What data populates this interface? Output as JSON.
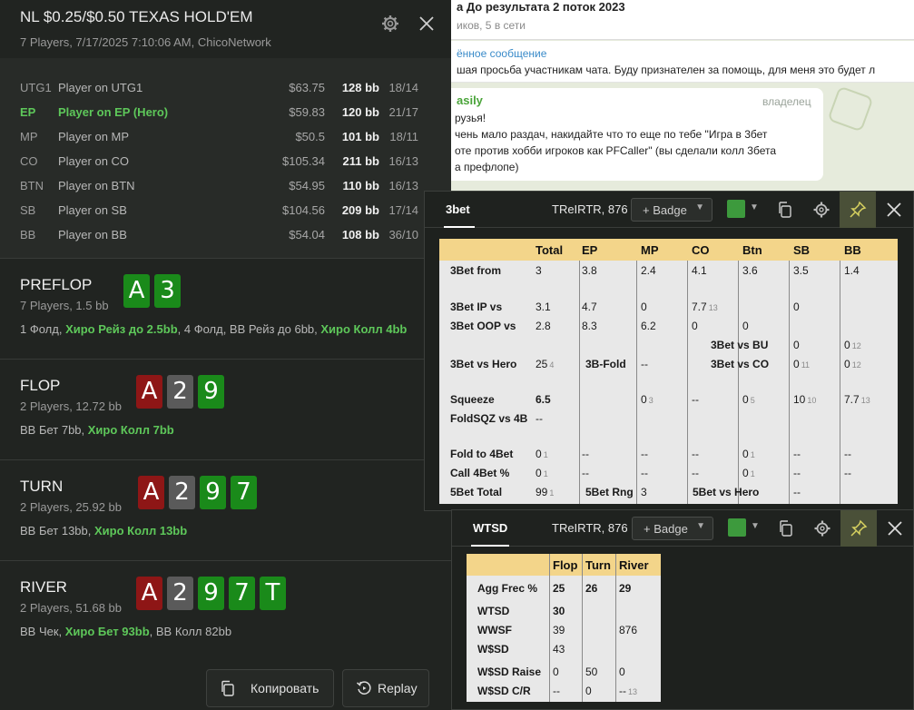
{
  "chat": {
    "title": "а До результата 2 поток 2023",
    "subtitle": "иков, 5 в сети",
    "pinned_title": "ённое сообщение",
    "pinned_text": "шая просьба участникам чата.   Буду признателен за помощь, для меня это будет л",
    "author": "asily",
    "role": "владелец",
    "lines": [
      "рузья!",
      "чень мало раздач, накидайте что то еще по тебе \"Игра в 3бет",
      "оте против хобби игроков как PFCaller\" (вы сделали колл 3бета",
      "а префлопе)"
    ]
  },
  "hand": {
    "title": "NL $0.25/$0.50 TEXAS HOLD'EM",
    "subtitle": "7 Players, 7/17/2025 7:10:06 AM, ChicoNetwork",
    "players": [
      {
        "pos": "UTG1",
        "name": "Player on UTG1",
        "money": "$63.75",
        "bb": "128 bb",
        "stat": "18/14",
        "hero": false
      },
      {
        "pos": "EP",
        "name": "Player on EP (Hero)",
        "money": "$59.83",
        "bb": "120 bb",
        "stat": "21/17",
        "hero": true
      },
      {
        "pos": "MP",
        "name": "Player on MP",
        "money": "$50.5",
        "bb": "101 bb",
        "stat": "18/11",
        "hero": false
      },
      {
        "pos": "CO",
        "name": "Player on CO",
        "money": "$105.34",
        "bb": "211 bb",
        "stat": "16/13",
        "hero": false
      },
      {
        "pos": "BTN",
        "name": "Player on BTN",
        "money": "$54.95",
        "bb": "110 bb",
        "stat": "16/13",
        "hero": false
      },
      {
        "pos": "SB",
        "name": "Player on SB",
        "money": "$104.56",
        "bb": "209 bb",
        "stat": "17/14",
        "hero": false
      },
      {
        "pos": "BB",
        "name": "Player on BB",
        "money": "$54.04",
        "bb": "108 bb",
        "stat": "36/10",
        "hero": false
      }
    ],
    "streets": [
      {
        "name": "PREFLOP",
        "players": "7 Players, 1.5 bb",
        "cards": [
          {
            "r": "A",
            "c": "green"
          },
          {
            "r": "3",
            "c": "green"
          }
        ],
        "action": [
          {
            "t": "1 Фолд, ",
            "g": false
          },
          {
            "t": "Хиро Рейз до 2.5bb",
            "g": true
          },
          {
            "t": ", 4 Фолд, BB Рейз до 6bb, ",
            "g": false
          },
          {
            "t": "Хиро Колл 4bb",
            "g": true
          }
        ]
      },
      {
        "name": "FLOP",
        "players": "2 Players, 12.72 bb",
        "cards": [
          {
            "r": "A",
            "c": "red"
          },
          {
            "r": "2",
            "c": "gray"
          },
          {
            "r": "9",
            "c": "green"
          }
        ],
        "action": [
          {
            "t": "BB Бет 7bb, ",
            "g": false
          },
          {
            "t": "Хиро Колл 7bb",
            "g": true
          }
        ]
      },
      {
        "name": "TURN",
        "players": "2 Players, 25.92 bb",
        "cards": [
          {
            "r": "A",
            "c": "red"
          },
          {
            "r": "2",
            "c": "gray"
          },
          {
            "r": "9",
            "c": "green"
          },
          {
            "r": "7",
            "c": "green"
          }
        ],
        "action": [
          {
            "t": "BB Бет 13bb, ",
            "g": false
          },
          {
            "t": "Хиро Колл 13bb",
            "g": true
          }
        ]
      },
      {
        "name": "RIVER",
        "players": "2 Players, 51.68 bb",
        "cards": [
          {
            "r": "A",
            "c": "red"
          },
          {
            "r": "2",
            "c": "gray"
          },
          {
            "r": "9",
            "c": "green"
          },
          {
            "r": "7",
            "c": "green"
          },
          {
            "r": "T",
            "c": "green"
          }
        ],
        "action": [
          {
            "t": "BB Чек, ",
            "g": false
          },
          {
            "t": "Хиро Бет 93bb",
            "g": true
          },
          {
            "t": ", BB Колл 82bb",
            "g": false
          }
        ]
      }
    ],
    "copy_label": "Копировать",
    "replay_label": "Replay"
  },
  "hud1": {
    "tab": "3bet",
    "player": "TReIRTR, 876",
    "badge": "+ Badge",
    "headers": [
      "Total",
      "EP",
      "MP",
      "CO",
      "Btn",
      "SB",
      "BB"
    ],
    "rows": [
      {
        "label": "3Bet from",
        "cells": [
          "3",
          "3.8",
          "2.4",
          "4.1",
          "3.6",
          "3.5",
          "1.4"
        ]
      },
      {
        "label": "3Bet IP vs",
        "cells": [
          "3.1",
          "4.7",
          "0",
          "7.7",
          "",
          "0",
          ""
        ],
        "small": [
          "",
          "",
          "",
          "13",
          "",
          "",
          ""
        ]
      },
      {
        "label": "3Bet OOP vs",
        "cells": [
          "2.8",
          "8.3",
          "6.2",
          "0",
          "0",
          "",
          ""
        ]
      },
      {
        "label": "3Bet vs BU",
        "v1": "0",
        "v2": "0",
        "v2s": "12"
      },
      {
        "label": "3Bet vs Hero",
        "total": "25",
        "totals": "4",
        "mid": "3B-Fold",
        "midv": "--",
        "lbl2": "3Bet vs CO",
        "v1": "0",
        "v1s": "11",
        "v2": "0",
        "v2s": "12"
      },
      {
        "label": "Squeeze",
        "cells": [
          "6.5",
          "",
          "0",
          "--",
          "0",
          "10",
          "7.7"
        ],
        "small": [
          "",
          "",
          "3",
          "",
          "5",
          "10",
          "13"
        ]
      },
      {
        "label": "FoldSQZ vs 4B",
        "cells": [
          "--",
          "",
          "",
          "",
          "",
          "",
          ""
        ]
      },
      {
        "label": "Fold to 4Bet",
        "cells": [
          "0",
          "--",
          "--",
          "--",
          "0",
          "--",
          "--"
        ],
        "small": [
          "1",
          "",
          "",
          "",
          "1",
          "",
          ""
        ]
      },
      {
        "label": "Call 4Bet %",
        "cells": [
          "0",
          "--",
          "--",
          "--",
          "0",
          "--",
          "--"
        ],
        "small": [
          "1",
          "",
          "",
          "",
          "1",
          "",
          ""
        ]
      },
      {
        "label": "5Bet Total",
        "total": "99",
        "totals": "1",
        "mid": "5Bet Rng",
        "midv": "3",
        "lbl2": "5Bet vs Hero",
        "v1": "--"
      }
    ]
  },
  "hud2": {
    "tab": "WTSD",
    "player": "TReIRTR, 876",
    "badge": "+ Badge",
    "headers": [
      "Flop",
      "Turn",
      "River"
    ],
    "rows": [
      {
        "label": "Agg Frec %",
        "cells": [
          "25",
          "26",
          "29"
        ]
      },
      {
        "label": "WTSD",
        "cells": [
          "30",
          "",
          ""
        ]
      },
      {
        "label": "WWSF",
        "cells": [
          "39",
          "",
          "876"
        ]
      },
      {
        "label": "W$SD",
        "cells": [
          "43",
          "",
          ""
        ]
      },
      {
        "label": "W$SD Raise",
        "cells": [
          "0",
          "50",
          "0"
        ]
      },
      {
        "label": "W$SD C/R",
        "cells": [
          "--",
          "0",
          "--"
        ],
        "small": [
          "",
          "",
          "13"
        ]
      }
    ]
  },
  "colors": {
    "accent_green": "#5ec85a",
    "header_yellow": "#f3d58a",
    "orange": "#e89416",
    "red": "#e02020"
  }
}
